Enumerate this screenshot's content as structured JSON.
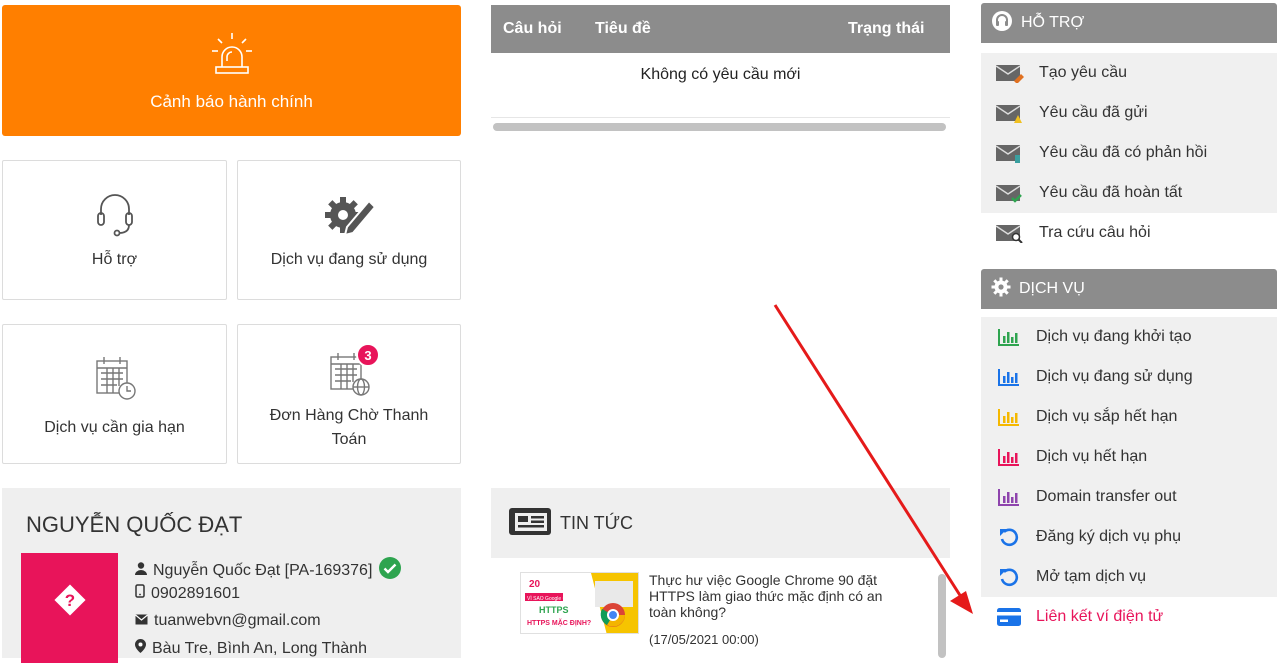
{
  "alert": {
    "label": "Cảnh báo hành chính",
    "icon": "siren-icon"
  },
  "tiles": [
    {
      "label": "Hỗ trợ",
      "icon": "headset-icon"
    },
    {
      "label": "Dịch vụ đang sử dụng",
      "icon": "gear-pencil-icon"
    },
    {
      "label": "Dịch vụ cần gia hạn",
      "icon": "calendar-clock-icon"
    },
    {
      "label": "Đơn Hàng Chờ Thanh Toán",
      "icon": "calendar-globe-icon",
      "badge": "3"
    }
  ],
  "requests": {
    "columns": [
      "Câu hỏi",
      "Tiêu đề",
      "Trạng thái"
    ],
    "empty_text": "Không có yêu cầu mới"
  },
  "profile": {
    "name": "NGUYỄN QUỐC ĐẠT",
    "fullname": "Nguyễn Quốc Đạt [PA-169376]",
    "phone": "0902891601",
    "email": "tuanwebvn@gmail.com",
    "address": "Bàu Tre, Bình An, Long Thành"
  },
  "news": {
    "title": "TIN TỨC",
    "items": [
      {
        "text": "Thực hư việc Google Chrome 90 đặt HTTPS làm giao thức mặc định có an toàn không?",
        "date": "(17/05/2021 00:00)",
        "thumb_label": "HTTPS MẶC ĐỊNH?"
      }
    ]
  },
  "support": {
    "title": "HỖ TRỢ",
    "items": [
      {
        "label": "Tạo yêu cầu",
        "icon": "mail-create-icon",
        "accent": "#e07020"
      },
      {
        "label": "Yêu cầu đã gửi",
        "icon": "mail-sent-icon",
        "accent": "#f0c020"
      },
      {
        "label": "Yêu cầu đã có phản hồi",
        "icon": "mail-reply-icon",
        "accent": "#3aa0a0"
      },
      {
        "label": "Yêu cầu đã hoàn tất",
        "icon": "mail-done-icon",
        "accent": "#2ea44f"
      },
      {
        "label": "Tra cứu câu hỏi",
        "icon": "mail-search-icon",
        "accent": "#333333"
      }
    ]
  },
  "services": {
    "title": "DỊCH VỤ",
    "items": [
      {
        "label": "Dịch vụ đang khởi tạo",
        "icon": "bar-chart-icon",
        "color": "#2ea44f"
      },
      {
        "label": "Dịch vụ đang sử dụng",
        "icon": "bar-chart-icon",
        "color": "#1a73e8"
      },
      {
        "label": "Dịch vụ sắp hết hạn",
        "icon": "bar-chart-icon",
        "color": "#f5b800"
      },
      {
        "label": "Dịch vụ hết hạn",
        "icon": "bar-chart-icon",
        "color": "#e8145a"
      },
      {
        "label": "Domain transfer out",
        "icon": "bar-chart-icon",
        "color": "#8e44ad"
      },
      {
        "label": "Đăng ký dịch vụ phụ",
        "icon": "undo-icon",
        "color": "#1a73e8"
      },
      {
        "label": "Mở tạm dịch vụ",
        "icon": "undo-icon",
        "color": "#1a73e8"
      },
      {
        "label": "Liên kết ví điện tử",
        "icon": "card-icon",
        "color": "#1a73e8"
      }
    ]
  },
  "colors": {
    "orange": "#ff7f00",
    "header_gray": "#8c8c8c",
    "pink": "#e8145a",
    "arrow": "#e51a1a"
  }
}
